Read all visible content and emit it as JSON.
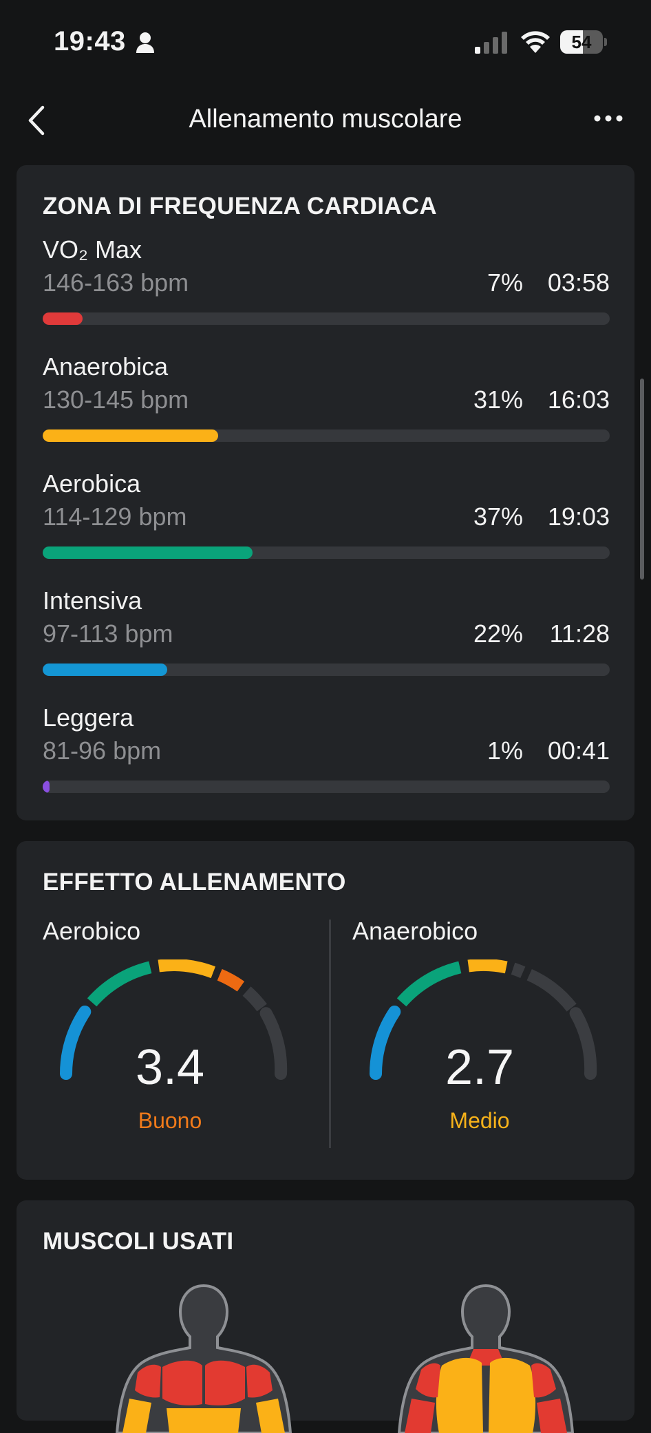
{
  "status_bar": {
    "time": "19:43",
    "battery_level": "54",
    "battery_fraction": 0.54
  },
  "nav": {
    "title": "Allenamento muscolare",
    "back_icon": "chevron-left-icon",
    "more_icon": "more-horizontal-icon"
  },
  "heart_zones": {
    "title": "ZONA DI FREQUENZA CARDIACA",
    "zones": [
      {
        "name": "VO₂ Max",
        "range": "146-163 bpm",
        "percent": "7%",
        "duration": "03:58",
        "fill": 0.07,
        "color": "#e03a3a"
      },
      {
        "name": "Anaerobica",
        "range": "130-145 bpm",
        "percent": "31%",
        "duration": "16:03",
        "fill": 0.31,
        "color": "#fbb117"
      },
      {
        "name": "Aerobica",
        "range": "114-129 bpm",
        "percent": "37%",
        "duration": "19:03",
        "fill": 0.37,
        "color": "#0aa37a"
      },
      {
        "name": "Intensiva",
        "range": "97-113 bpm",
        "percent": "22%",
        "duration": "11:28",
        "fill": 0.22,
        "color": "#1496d4"
      },
      {
        "name": "Leggera",
        "range": "81-96 bpm",
        "percent": "1%",
        "duration": "00:41",
        "fill": 0.012,
        "color": "#8a4fe0"
      }
    ]
  },
  "training_effect": {
    "title": "EFFETTO ALLENAMENTO",
    "aerobic": {
      "label": "Aerobico",
      "value": "3.4",
      "rating": "Buono",
      "rating_color": "#f07a1a"
    },
    "anaerobic": {
      "label": "Anaerobico",
      "value": "2.7",
      "rating": "Medio",
      "rating_color": "#f7b21a"
    }
  },
  "muscles": {
    "title": "MUSCOLI USATI"
  }
}
